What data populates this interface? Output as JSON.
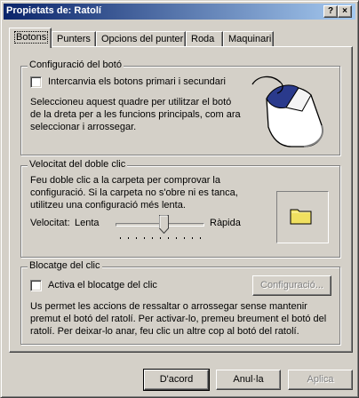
{
  "window": {
    "title": "Propietats de: Ratolí",
    "help_button": "?",
    "close_button": "×"
  },
  "tabs": [
    {
      "label": "Botons",
      "active": true
    },
    {
      "label": "Punters"
    },
    {
      "label": "Opcions del punter"
    },
    {
      "label": "Roda"
    },
    {
      "label": "Maquinari"
    }
  ],
  "button_config": {
    "legend": "Configuració del botó",
    "checkbox_label": "Intercanvia els botons primari i secundari",
    "checked": false,
    "description": "Seleccioneu aquest quadre per utilitzar el botó de la dreta per a les funcions principals, com ara seleccionar i arrossegar."
  },
  "double_click": {
    "legend": "Velocitat del doble clic",
    "description": "Feu doble clic a la carpeta per comprovar la configuració. Si la carpeta no s'obre ni es tanca, utilitzeu una configuració més lenta.",
    "speed_label": "Velocitat:",
    "slow_label": "Lenta",
    "fast_label": "Ràpida",
    "speed_level": 0.55,
    "test_icon": "folder-icon"
  },
  "click_lock": {
    "legend": "Blocatge del clic",
    "checkbox_label": "Activa el blocatge del clic",
    "checked": false,
    "settings_button": "Configuració...",
    "description": "Us permet les accions de ressaltar o arrossegar sense mantenir premut el botó del ratolí. Per activar-lo, premeu breument el botó del ratolí. Per deixar-lo anar, feu clic un altre cop al botó del ratolí."
  },
  "footer": {
    "ok": "D'acord",
    "cancel": "Anul·la",
    "apply": "Aplica"
  },
  "colors": {
    "titlebar_start": "#0a246a",
    "titlebar_end": "#a6caf0",
    "face": "#d4d0c8",
    "mouse_button": "#2a3a8c",
    "folder": "#f0e060"
  }
}
